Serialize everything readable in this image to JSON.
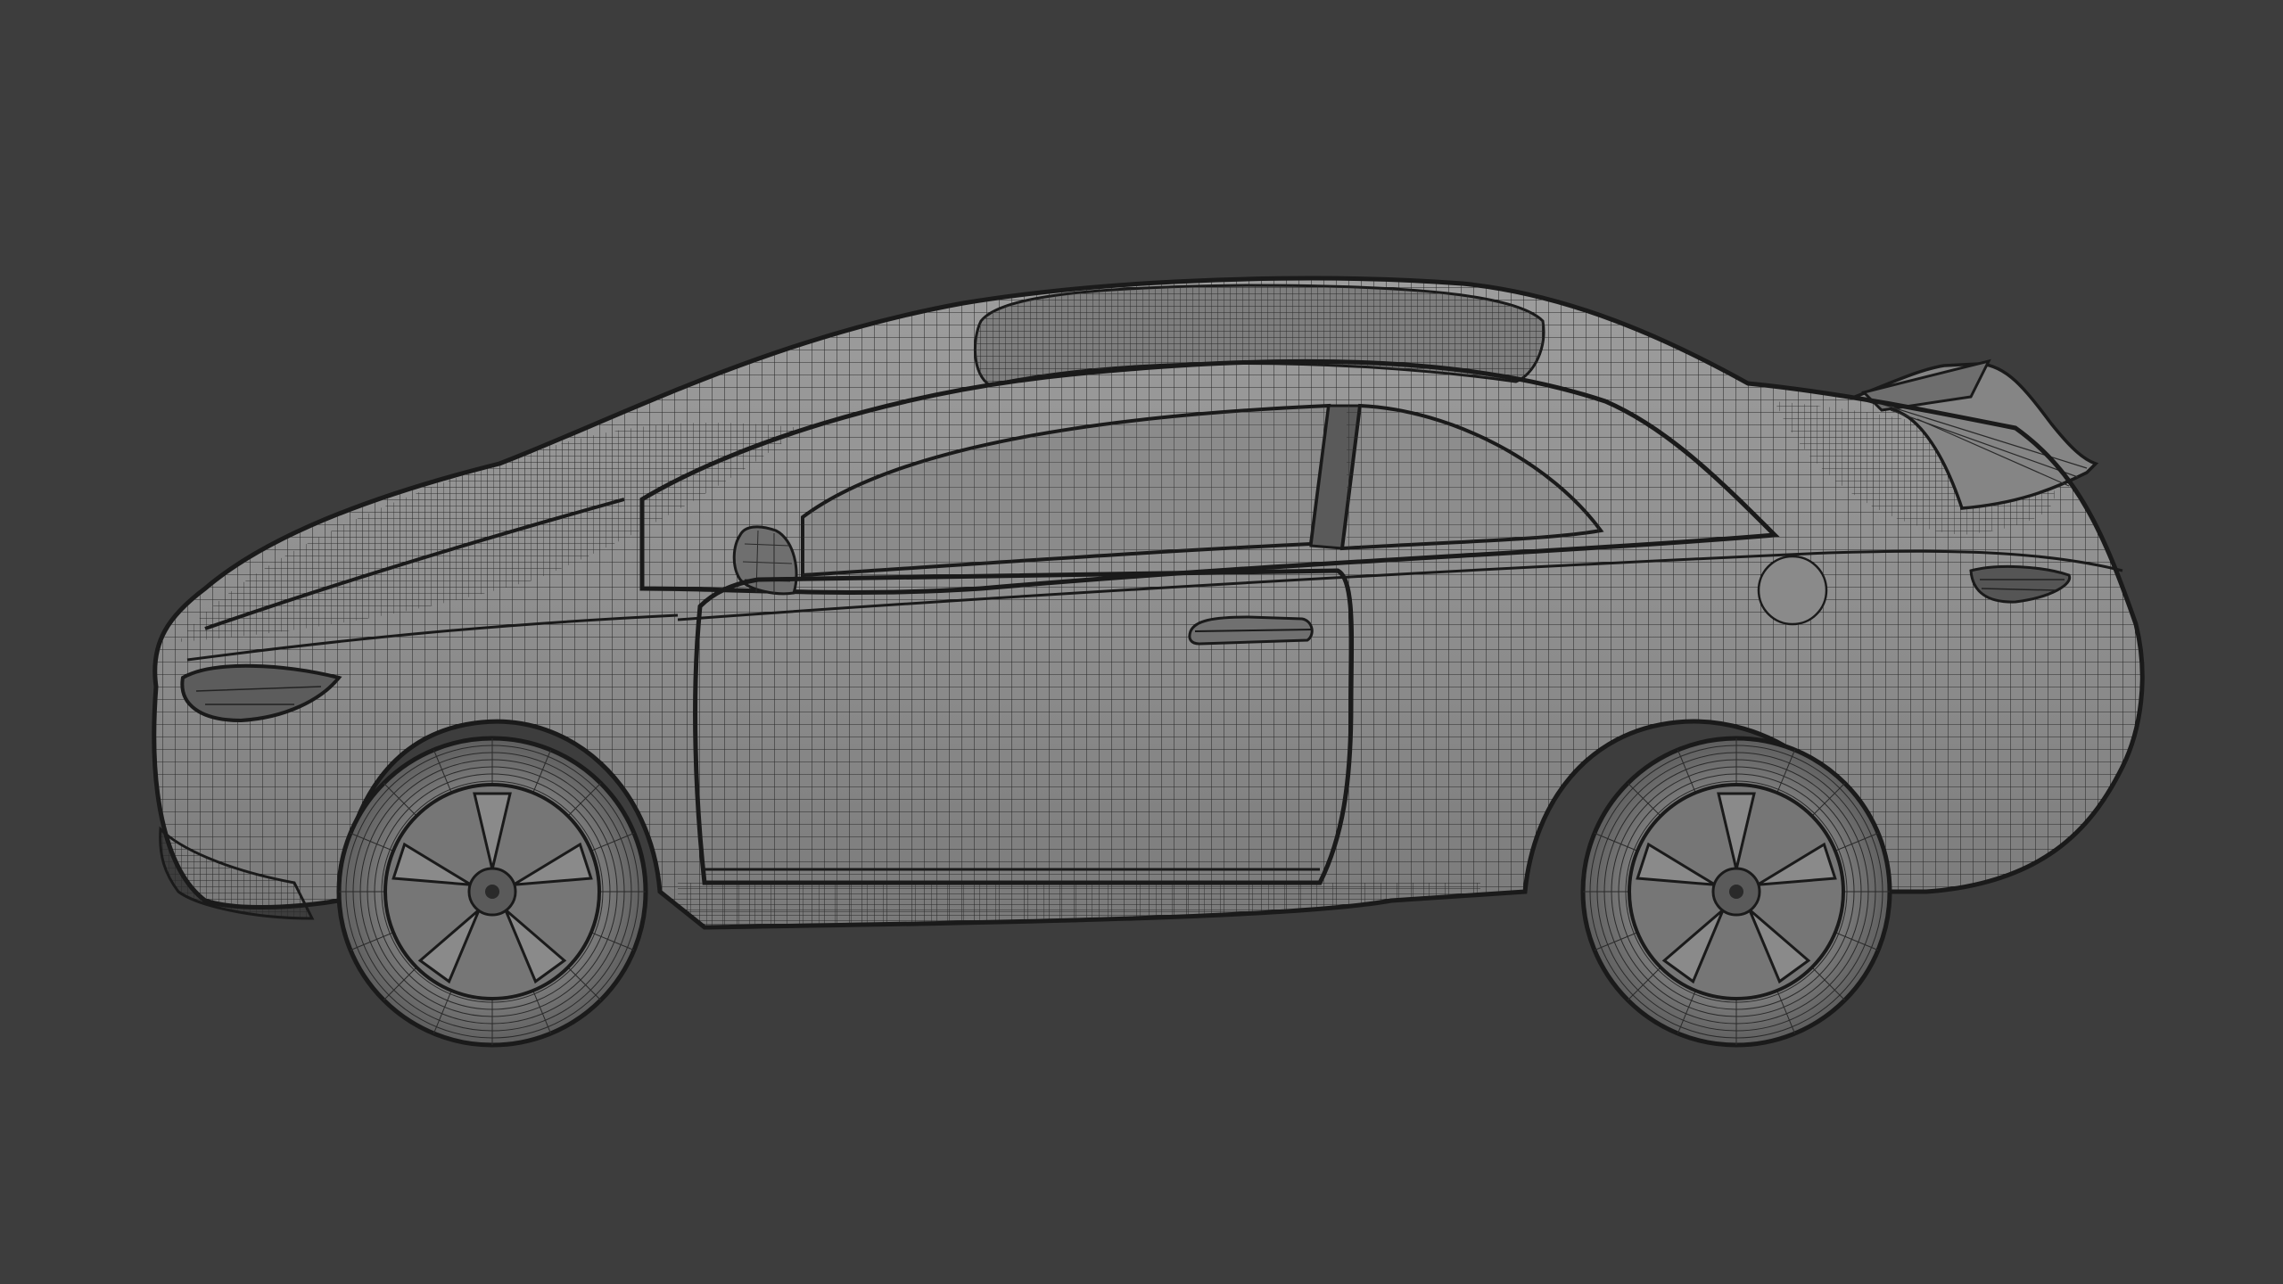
{
  "viewport": {
    "background": "#3d3d3d",
    "shading": "wireframe-over-solid",
    "subject": "car-side-view",
    "colors": {
      "surface": "#8e8e8e",
      "surface_light": "#a2a2a2",
      "surface_dark": "#6f6f6f",
      "glass": "#8a8a8a",
      "tire": "#747474",
      "wire": "#2a2a2a",
      "outline": "#1a1a1a"
    }
  }
}
